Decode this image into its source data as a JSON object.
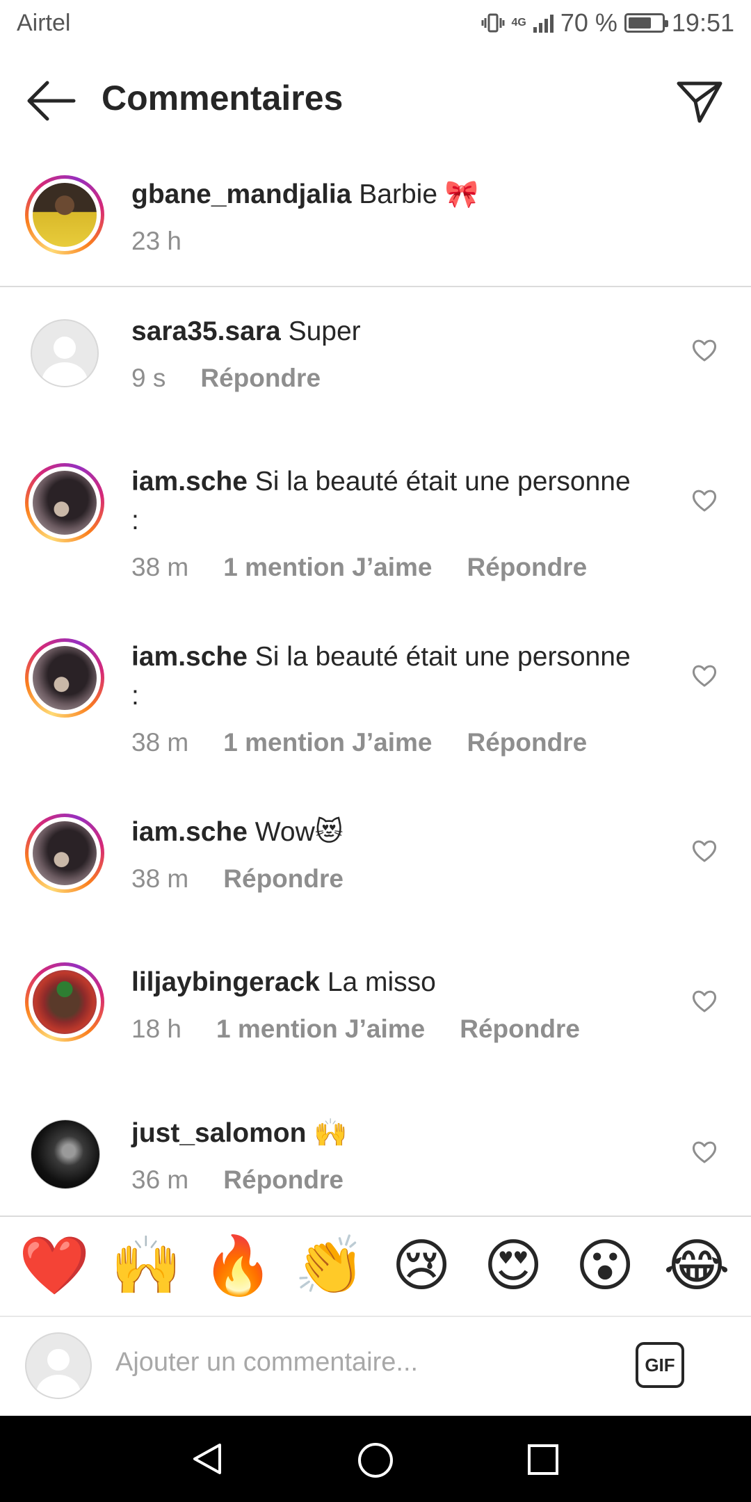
{
  "status_bar": {
    "carrier": "Airtel",
    "network": "4G",
    "battery_percent": "70 %",
    "battery_level": 0.7,
    "time": "19:51"
  },
  "header": {
    "title": "Commentaires",
    "back_icon": "arrow-left-icon",
    "share_icon": "paper-plane-icon"
  },
  "caption": {
    "username": "gbane_mandjalia",
    "text": "Barbie 🎀",
    "time": "23 h"
  },
  "comments": [
    {
      "username": "sara35.sara",
      "text": "Super",
      "line2": "",
      "time": "9 s",
      "likes": "",
      "reply": "Répondre",
      "avatar": "placeholder"
    },
    {
      "username": "iam.sche",
      "text": "Si la beauté était une personne",
      "line2": ":",
      "time": "38 m",
      "likes": "1 mention J’aime",
      "reply": "Répondre",
      "avatar": "story"
    },
    {
      "username": "iam.sche",
      "text": "Si la beauté était une personne",
      "line2": ":",
      "time": "38 m",
      "likes": "1 mention J’aime",
      "reply": "Répondre",
      "avatar": "story"
    },
    {
      "username": "iam.sche",
      "text": "Wow😻",
      "line2": "",
      "time": "38 m",
      "likes": "",
      "reply": "Répondre",
      "avatar": "story"
    },
    {
      "username": "liljaybingerack",
      "text": "La misso",
      "line2": "",
      "time": "18 h",
      "likes": "1 mention J’aime",
      "reply": "Répondre",
      "avatar": "story"
    },
    {
      "username": "just_salomon",
      "text": "🙌",
      "line2": "",
      "time": "36 m",
      "likes": "",
      "reply": "Répondre",
      "avatar": "dark"
    }
  ],
  "quick_emojis": [
    "❤️",
    "🙌",
    "🔥",
    "👏",
    "😢",
    "😍",
    "😮",
    "😂"
  ],
  "composer": {
    "placeholder": "Ajouter un commentaire...",
    "gif_label": "GIF"
  },
  "nav_icons": [
    "back-triangle-icon",
    "home-circle-icon",
    "recents-square-icon"
  ],
  "colors": {
    "text": "#262626",
    "secondary_text": "#8e8e8e",
    "divider": "#dbdbdb",
    "navbar": "#000000"
  }
}
